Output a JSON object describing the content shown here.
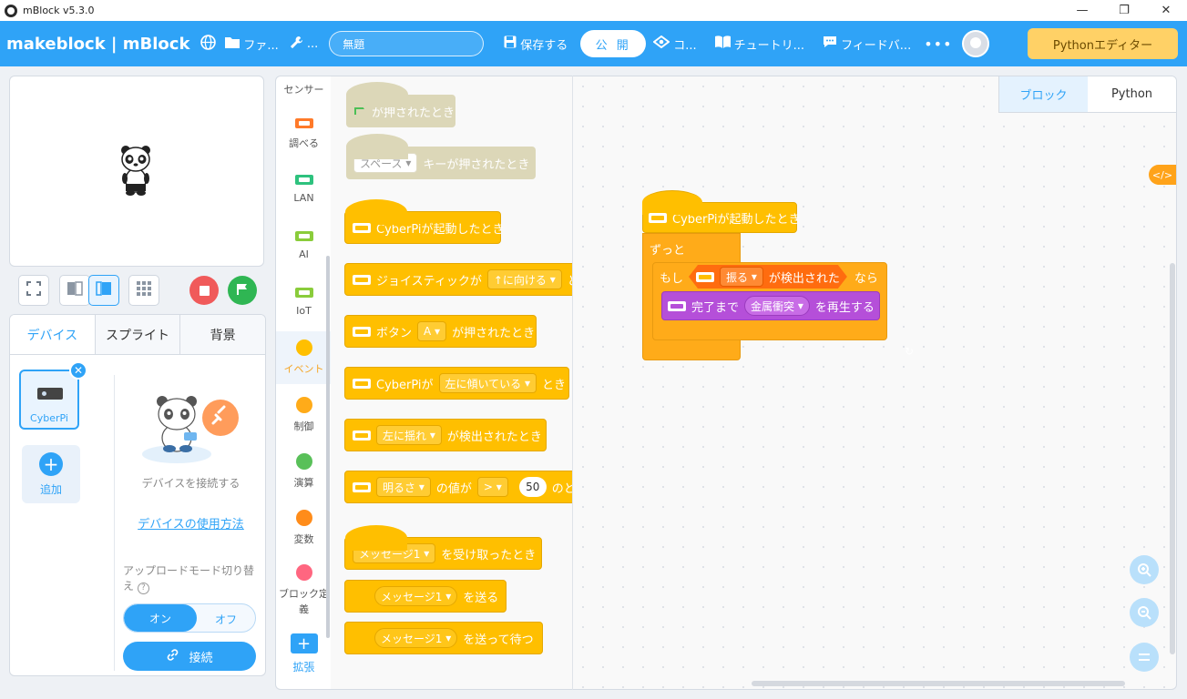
{
  "window": {
    "title": "mBlock v5.3.0",
    "minimize": "—",
    "maximize": "❐",
    "close": "✕"
  },
  "menubar": {
    "brand": "makeblock | mBlock",
    "file": "ファ...",
    "edit": "...",
    "project_name": "無題",
    "save": "保存する",
    "publish": "公 開",
    "connect_menu": "コ...",
    "tutorial": "チュートリ...",
    "feedback": "フィードバ...",
    "more": "•••",
    "python_editor": "Pythonエディター"
  },
  "device_panel": {
    "tabs": [
      "デバイス",
      "スプライト",
      "背景"
    ],
    "active_tab": "デバイス",
    "device_name": "CyberPi",
    "add_label": "追加",
    "connect_prompt": "デバイスを接続する",
    "howto_link": "デバイスの使用方法",
    "upload_mode_label": "アップロードモード切り替え",
    "toggle_on": "オン",
    "toggle_off": "オフ",
    "connect_button": "接続"
  },
  "categories": [
    {
      "label": "センサー",
      "color": "#ff7a29"
    },
    {
      "label": "調べる",
      "color": "#ff7a29"
    },
    {
      "label": "LAN",
      "color": "#2ec27e"
    },
    {
      "label": "AI",
      "color": "#8acc3b"
    },
    {
      "label": "IoT",
      "color": "#8acc3b"
    },
    {
      "label": "イベント",
      "color": "#ffbf00"
    },
    {
      "label": "制御",
      "color": "#ffab19"
    },
    {
      "label": "演算",
      "color": "#59c059"
    },
    {
      "label": "変数",
      "color": "#ff8c1a"
    },
    {
      "label": "ブロック定義",
      "color": "#ff6680"
    },
    {
      "label": "拡張",
      "color": "#2fa3f7"
    }
  ],
  "palette": {
    "flag_clicked": "が押されたとき",
    "key_dropdown": "スペース",
    "key_pressed": "キーが押されたとき",
    "cyberpi_start": "CyberPiが起動したとき",
    "joystick_prefix": "ジョイスティックが",
    "joystick_dropdown": "↑に向ける",
    "joystick_suffix": "と",
    "button_prefix": "ボタン",
    "button_dropdown": "A",
    "button_suffix": "が押されたとき",
    "tilt_prefix": "CyberPiが",
    "tilt_dropdown": "左に傾いている",
    "tilt_suffix": "とき",
    "shake_dropdown": "左に揺れ",
    "shake_suffix": "が検出されたとき",
    "sensor_dropdown": "明るさ",
    "sensor_mid": "の値が",
    "compare_dropdown": ">",
    "compare_value": "50",
    "sensor_suffix": "のと",
    "message_dropdown": "メッセージ1",
    "receive_suffix": "を受け取ったとき",
    "send_suffix": "を送る",
    "send_wait_suffix": "を送って待つ"
  },
  "script": {
    "view_tabs": [
      "ブロック",
      "Python"
    ],
    "active_view": "ブロック",
    "code_toggle": "</>",
    "hat": "CyberPiが起動したとき",
    "forever": "ずっと",
    "if_label": "もし",
    "condition_dropdown": "振る",
    "condition_suffix": "が検出された",
    "then_label": "なら",
    "play_prefix": "完了まで",
    "sound_dropdown": "金属衝突",
    "play_suffix": "を再生する"
  }
}
